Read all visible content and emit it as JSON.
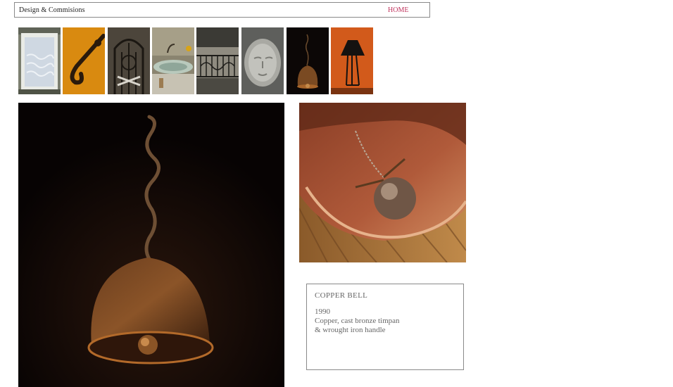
{
  "header": {
    "site_title": "Design & Commisions",
    "home_label": "HOME"
  },
  "thumbnails": [
    {
      "subject": "window"
    },
    {
      "subject": "wrought-iron-handle"
    },
    {
      "subject": "iron-gate"
    },
    {
      "subject": "sink-basin"
    },
    {
      "subject": "balcony-railing"
    },
    {
      "subject": "stone-face"
    },
    {
      "subject": "copper-bell"
    },
    {
      "subject": "table-lamp"
    }
  ],
  "main_image": {
    "subject": "copper-bell"
  },
  "detail_image": {
    "subject": "copper-bell-timpan"
  },
  "caption": {
    "title": "COPPER BELL",
    "year": "1990",
    "line1": "Copper, cast bronze timpan",
    "line2": "& wrought iron handle"
  }
}
